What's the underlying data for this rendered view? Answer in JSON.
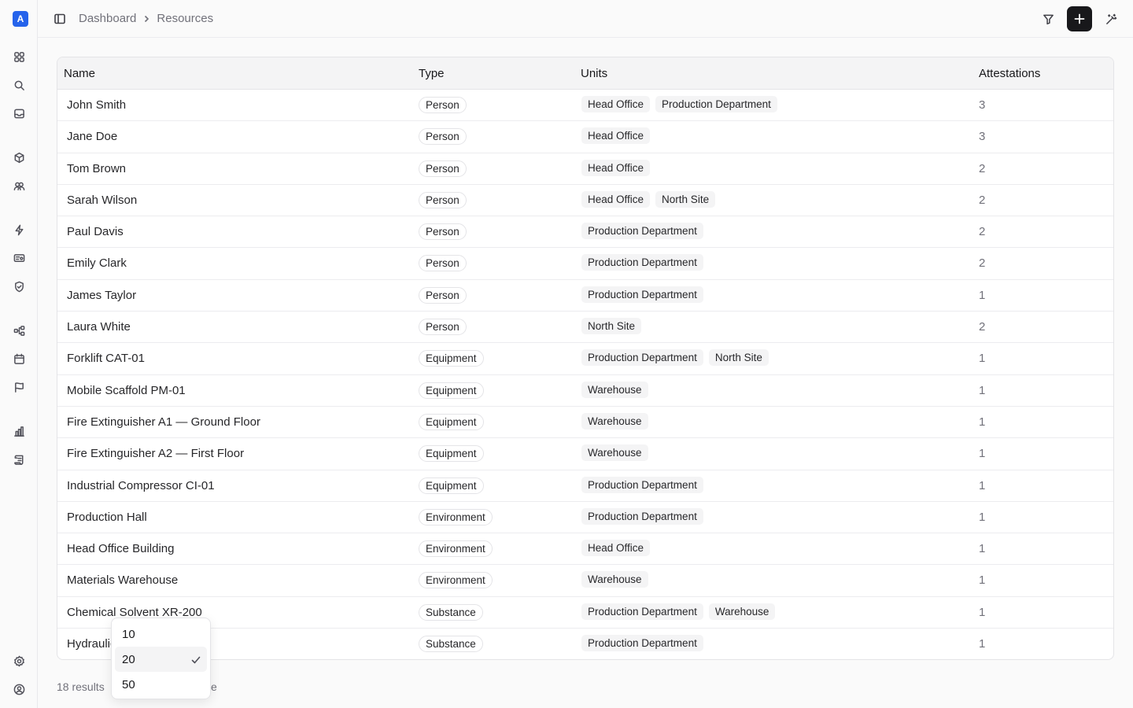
{
  "app": {
    "logo_letter": "A",
    "accent": "#2563eb"
  },
  "sidebar": {
    "icons": [
      "grid-icon",
      "search-icon",
      "inbox-icon",
      "box-icon",
      "users-icon",
      "zap-icon",
      "id-card-icon",
      "shield-check-icon",
      "workflow-icon",
      "calendar-icon",
      "flag-icon",
      "bar-chart-icon",
      "scroll-icon",
      "settings-icon",
      "user-circle-icon"
    ]
  },
  "header": {
    "breadcrumb": [
      "Dashboard",
      "Resources"
    ]
  },
  "table": {
    "columns": [
      "Name",
      "Type",
      "Units",
      "Attestations"
    ],
    "rows": [
      {
        "name": "John Smith",
        "type": "Person",
        "units": [
          "Head Office",
          "Production Department"
        ],
        "attestations": "3"
      },
      {
        "name": "Jane Doe",
        "type": "Person",
        "units": [
          "Head Office"
        ],
        "attestations": "3"
      },
      {
        "name": "Tom Brown",
        "type": "Person",
        "units": [
          "Head Office"
        ],
        "attestations": "2"
      },
      {
        "name": "Sarah Wilson",
        "type": "Person",
        "units": [
          "Head Office",
          "North Site"
        ],
        "attestations": "2"
      },
      {
        "name": "Paul Davis",
        "type": "Person",
        "units": [
          "Production Department"
        ],
        "attestations": "2"
      },
      {
        "name": "Emily Clark",
        "type": "Person",
        "units": [
          "Production Department"
        ],
        "attestations": "2"
      },
      {
        "name": "James Taylor",
        "type": "Person",
        "units": [
          "Production Department"
        ],
        "attestations": "1"
      },
      {
        "name": "Laura White",
        "type": "Person",
        "units": [
          "North Site"
        ],
        "attestations": "2"
      },
      {
        "name": "Forklift CAT-01",
        "type": "Equipment",
        "units": [
          "Production Department",
          "North Site"
        ],
        "attestations": "1"
      },
      {
        "name": "Mobile Scaffold PM-01",
        "type": "Equipment",
        "units": [
          "Warehouse"
        ],
        "attestations": "1"
      },
      {
        "name": "Fire Extinguisher A1 — Ground Floor",
        "type": "Equipment",
        "units": [
          "Warehouse"
        ],
        "attestations": "1"
      },
      {
        "name": "Fire Extinguisher A2 — First Floor",
        "type": "Equipment",
        "units": [
          "Warehouse"
        ],
        "attestations": "1"
      },
      {
        "name": "Industrial Compressor CI-01",
        "type": "Equipment",
        "units": [
          "Production Department"
        ],
        "attestations": "1"
      },
      {
        "name": "Production Hall",
        "type": "Environment",
        "units": [
          "Production Department"
        ],
        "attestations": "1"
      },
      {
        "name": "Head Office Building",
        "type": "Environment",
        "units": [
          "Head Office"
        ],
        "attestations": "1"
      },
      {
        "name": "Materials Warehouse",
        "type": "Environment",
        "units": [
          "Warehouse"
        ],
        "attestations": "1"
      },
      {
        "name": "Chemical Solvent XR-200",
        "type": "Substance",
        "units": [
          "Production Department",
          "Warehouse"
        ],
        "attestations": "1"
      },
      {
        "name": "Hydraulic",
        "type": "Substance",
        "units": [
          "Production Department"
        ],
        "attestations": "1"
      }
    ]
  },
  "footer": {
    "results_text": "18 results",
    "partial_text": "e"
  },
  "page_size_dropdown": {
    "options": [
      "10",
      "20",
      "50"
    ],
    "selected": "20"
  }
}
